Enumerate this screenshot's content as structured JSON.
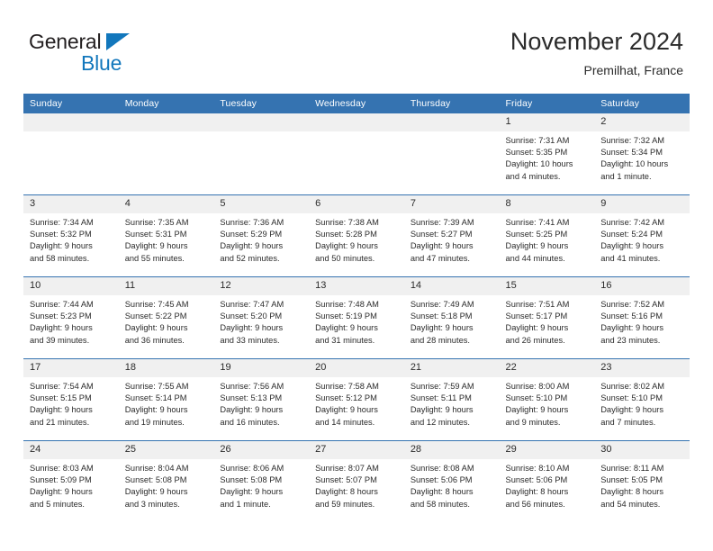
{
  "brand": {
    "name_part1": "General",
    "name_part2": "Blue",
    "triangle_color": "#1277bc"
  },
  "header": {
    "title": "November 2024",
    "subtitle": "Premilhat, France",
    "accent_color": "#3573b1",
    "daynum_band_color": "#f0f0f0"
  },
  "calendar": {
    "weekday_headers": [
      "Sunday",
      "Monday",
      "Tuesday",
      "Wednesday",
      "Thursday",
      "Friday",
      "Saturday"
    ],
    "labels": {
      "sunrise": "Sunrise:",
      "sunset": "Sunset:",
      "daylight": "Daylight:"
    },
    "weeks": [
      [
        {
          "day": "",
          "sunrise": "",
          "sunset": "",
          "daylight_line1": "",
          "daylight_line2": ""
        },
        {
          "day": "",
          "sunrise": "",
          "sunset": "",
          "daylight_line1": "",
          "daylight_line2": ""
        },
        {
          "day": "",
          "sunrise": "",
          "sunset": "",
          "daylight_line1": "",
          "daylight_line2": ""
        },
        {
          "day": "",
          "sunrise": "",
          "sunset": "",
          "daylight_line1": "",
          "daylight_line2": ""
        },
        {
          "day": "",
          "sunrise": "",
          "sunset": "",
          "daylight_line1": "",
          "daylight_line2": ""
        },
        {
          "day": "1",
          "sunrise": "Sunrise: 7:31 AM",
          "sunset": "Sunset: 5:35 PM",
          "daylight_line1": "Daylight: 10 hours",
          "daylight_line2": "and 4 minutes."
        },
        {
          "day": "2",
          "sunrise": "Sunrise: 7:32 AM",
          "sunset": "Sunset: 5:34 PM",
          "daylight_line1": "Daylight: 10 hours",
          "daylight_line2": "and 1 minute."
        }
      ],
      [
        {
          "day": "3",
          "sunrise": "Sunrise: 7:34 AM",
          "sunset": "Sunset: 5:32 PM",
          "daylight_line1": "Daylight: 9 hours",
          "daylight_line2": "and 58 minutes."
        },
        {
          "day": "4",
          "sunrise": "Sunrise: 7:35 AM",
          "sunset": "Sunset: 5:31 PM",
          "daylight_line1": "Daylight: 9 hours",
          "daylight_line2": "and 55 minutes."
        },
        {
          "day": "5",
          "sunrise": "Sunrise: 7:36 AM",
          "sunset": "Sunset: 5:29 PM",
          "daylight_line1": "Daylight: 9 hours",
          "daylight_line2": "and 52 minutes."
        },
        {
          "day": "6",
          "sunrise": "Sunrise: 7:38 AM",
          "sunset": "Sunset: 5:28 PM",
          "daylight_line1": "Daylight: 9 hours",
          "daylight_line2": "and 50 minutes."
        },
        {
          "day": "7",
          "sunrise": "Sunrise: 7:39 AM",
          "sunset": "Sunset: 5:27 PM",
          "daylight_line1": "Daylight: 9 hours",
          "daylight_line2": "and 47 minutes."
        },
        {
          "day": "8",
          "sunrise": "Sunrise: 7:41 AM",
          "sunset": "Sunset: 5:25 PM",
          "daylight_line1": "Daylight: 9 hours",
          "daylight_line2": "and 44 minutes."
        },
        {
          "day": "9",
          "sunrise": "Sunrise: 7:42 AM",
          "sunset": "Sunset: 5:24 PM",
          "daylight_line1": "Daylight: 9 hours",
          "daylight_line2": "and 41 minutes."
        }
      ],
      [
        {
          "day": "10",
          "sunrise": "Sunrise: 7:44 AM",
          "sunset": "Sunset: 5:23 PM",
          "daylight_line1": "Daylight: 9 hours",
          "daylight_line2": "and 39 minutes."
        },
        {
          "day": "11",
          "sunrise": "Sunrise: 7:45 AM",
          "sunset": "Sunset: 5:22 PM",
          "daylight_line1": "Daylight: 9 hours",
          "daylight_line2": "and 36 minutes."
        },
        {
          "day": "12",
          "sunrise": "Sunrise: 7:47 AM",
          "sunset": "Sunset: 5:20 PM",
          "daylight_line1": "Daylight: 9 hours",
          "daylight_line2": "and 33 minutes."
        },
        {
          "day": "13",
          "sunrise": "Sunrise: 7:48 AM",
          "sunset": "Sunset: 5:19 PM",
          "daylight_line1": "Daylight: 9 hours",
          "daylight_line2": "and 31 minutes."
        },
        {
          "day": "14",
          "sunrise": "Sunrise: 7:49 AM",
          "sunset": "Sunset: 5:18 PM",
          "daylight_line1": "Daylight: 9 hours",
          "daylight_line2": "and 28 minutes."
        },
        {
          "day": "15",
          "sunrise": "Sunrise: 7:51 AM",
          "sunset": "Sunset: 5:17 PM",
          "daylight_line1": "Daylight: 9 hours",
          "daylight_line2": "and 26 minutes."
        },
        {
          "day": "16",
          "sunrise": "Sunrise: 7:52 AM",
          "sunset": "Sunset: 5:16 PM",
          "daylight_line1": "Daylight: 9 hours",
          "daylight_line2": "and 23 minutes."
        }
      ],
      [
        {
          "day": "17",
          "sunrise": "Sunrise: 7:54 AM",
          "sunset": "Sunset: 5:15 PM",
          "daylight_line1": "Daylight: 9 hours",
          "daylight_line2": "and 21 minutes."
        },
        {
          "day": "18",
          "sunrise": "Sunrise: 7:55 AM",
          "sunset": "Sunset: 5:14 PM",
          "daylight_line1": "Daylight: 9 hours",
          "daylight_line2": "and 19 minutes."
        },
        {
          "day": "19",
          "sunrise": "Sunrise: 7:56 AM",
          "sunset": "Sunset: 5:13 PM",
          "daylight_line1": "Daylight: 9 hours",
          "daylight_line2": "and 16 minutes."
        },
        {
          "day": "20",
          "sunrise": "Sunrise: 7:58 AM",
          "sunset": "Sunset: 5:12 PM",
          "daylight_line1": "Daylight: 9 hours",
          "daylight_line2": "and 14 minutes."
        },
        {
          "day": "21",
          "sunrise": "Sunrise: 7:59 AM",
          "sunset": "Sunset: 5:11 PM",
          "daylight_line1": "Daylight: 9 hours",
          "daylight_line2": "and 12 minutes."
        },
        {
          "day": "22",
          "sunrise": "Sunrise: 8:00 AM",
          "sunset": "Sunset: 5:10 PM",
          "daylight_line1": "Daylight: 9 hours",
          "daylight_line2": "and 9 minutes."
        },
        {
          "day": "23",
          "sunrise": "Sunrise: 8:02 AM",
          "sunset": "Sunset: 5:10 PM",
          "daylight_line1": "Daylight: 9 hours",
          "daylight_line2": "and 7 minutes."
        }
      ],
      [
        {
          "day": "24",
          "sunrise": "Sunrise: 8:03 AM",
          "sunset": "Sunset: 5:09 PM",
          "daylight_line1": "Daylight: 9 hours",
          "daylight_line2": "and 5 minutes."
        },
        {
          "day": "25",
          "sunrise": "Sunrise: 8:04 AM",
          "sunset": "Sunset: 5:08 PM",
          "daylight_line1": "Daylight: 9 hours",
          "daylight_line2": "and 3 minutes."
        },
        {
          "day": "26",
          "sunrise": "Sunrise: 8:06 AM",
          "sunset": "Sunset: 5:08 PM",
          "daylight_line1": "Daylight: 9 hours",
          "daylight_line2": "and 1 minute."
        },
        {
          "day": "27",
          "sunrise": "Sunrise: 8:07 AM",
          "sunset": "Sunset: 5:07 PM",
          "daylight_line1": "Daylight: 8 hours",
          "daylight_line2": "and 59 minutes."
        },
        {
          "day": "28",
          "sunrise": "Sunrise: 8:08 AM",
          "sunset": "Sunset: 5:06 PM",
          "daylight_line1": "Daylight: 8 hours",
          "daylight_line2": "and 58 minutes."
        },
        {
          "day": "29",
          "sunrise": "Sunrise: 8:10 AM",
          "sunset": "Sunset: 5:06 PM",
          "daylight_line1": "Daylight: 8 hours",
          "daylight_line2": "and 56 minutes."
        },
        {
          "day": "30",
          "sunrise": "Sunrise: 8:11 AM",
          "sunset": "Sunset: 5:05 PM",
          "daylight_line1": "Daylight: 8 hours",
          "daylight_line2": "and 54 minutes."
        }
      ]
    ]
  }
}
